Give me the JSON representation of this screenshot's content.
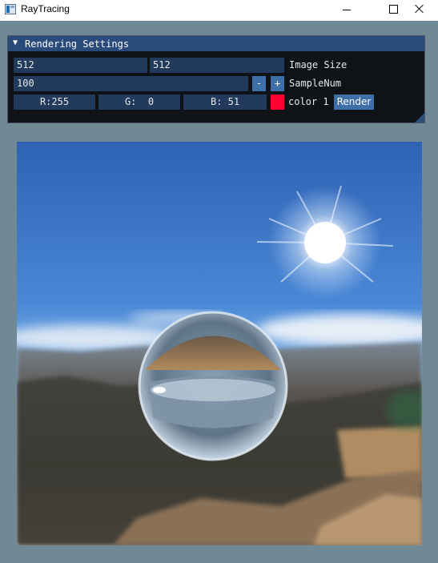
{
  "window": {
    "title": "RayTracing"
  },
  "panel": {
    "title": "Rendering Settings",
    "image_width": "512",
    "image_height": "512",
    "image_size_label": "Image Size",
    "sample_num": "100",
    "minus_label": "-",
    "plus_label": "+",
    "sample_num_label": "SampleNum",
    "color_r": "R:255",
    "color_g": "G:  0",
    "color_b": "B: 51",
    "color_swatch": "#ff0033",
    "color_label": "color 1",
    "render_label": "Render"
  },
  "colors": {
    "client_background": "#718995",
    "panel_header": "#294a7a",
    "field_background": "#223a5c",
    "button": "#3f6fa8"
  }
}
